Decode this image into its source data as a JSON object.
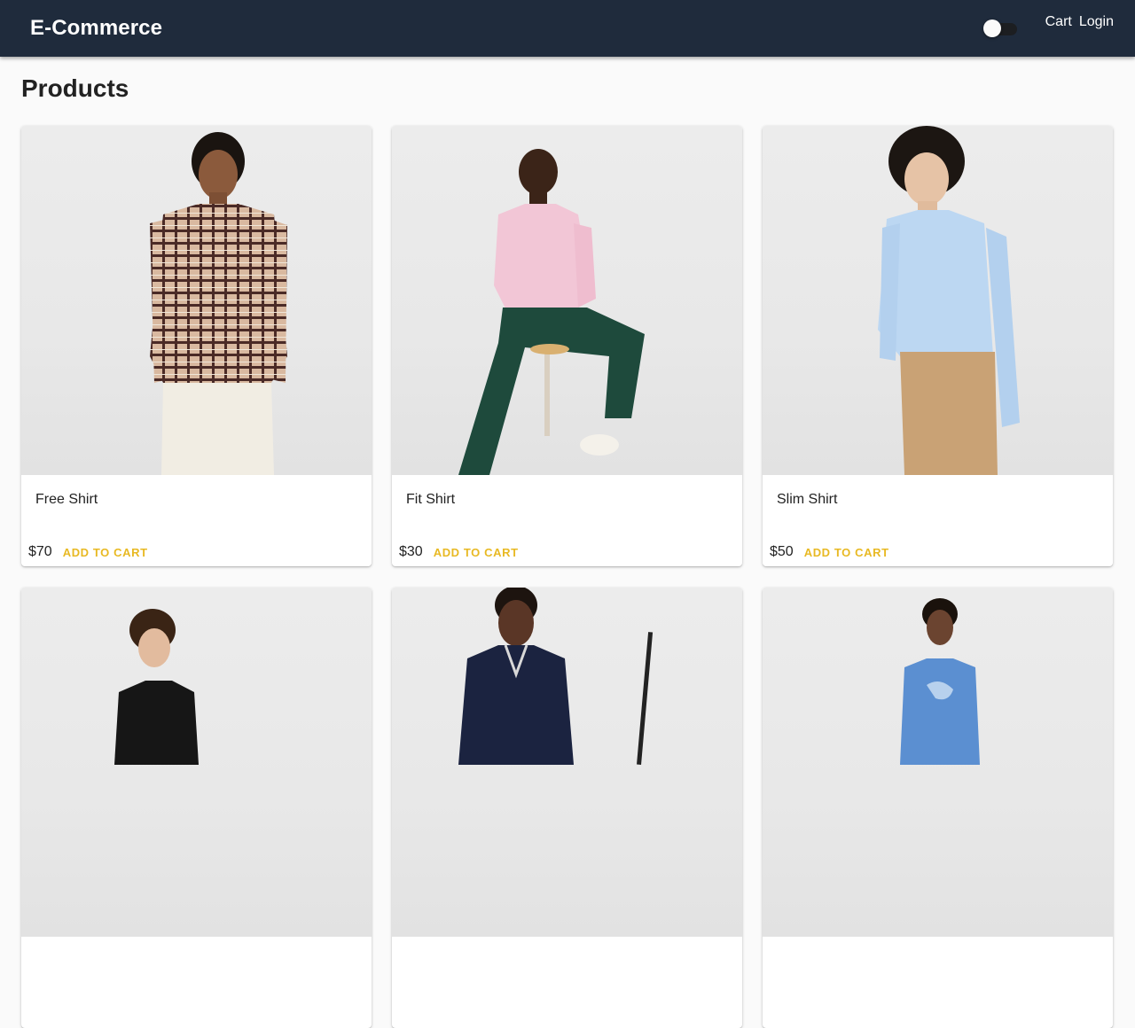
{
  "header": {
    "brand": "E-Commerce",
    "theme_toggle": {
      "state": "off",
      "icon": "toggle-switch"
    },
    "nav": {
      "cart": "Cart",
      "login": "Login"
    }
  },
  "page": {
    "title": "Products"
  },
  "colors": {
    "appbar": "#1f2b3c",
    "accent": "#e8b923",
    "background": "#fafafa"
  },
  "products": [
    {
      "name": "Free Shirt",
      "price": "$70",
      "action": "ADD TO CART"
    },
    {
      "name": "Fit Shirt",
      "price": "$30",
      "action": "ADD TO CART"
    },
    {
      "name": "Slim Shirt",
      "price": "$50",
      "action": "ADD TO CART"
    },
    {
      "name": "",
      "price": "",
      "action": ""
    },
    {
      "name": "",
      "price": "",
      "action": ""
    },
    {
      "name": "",
      "price": "",
      "action": ""
    }
  ]
}
